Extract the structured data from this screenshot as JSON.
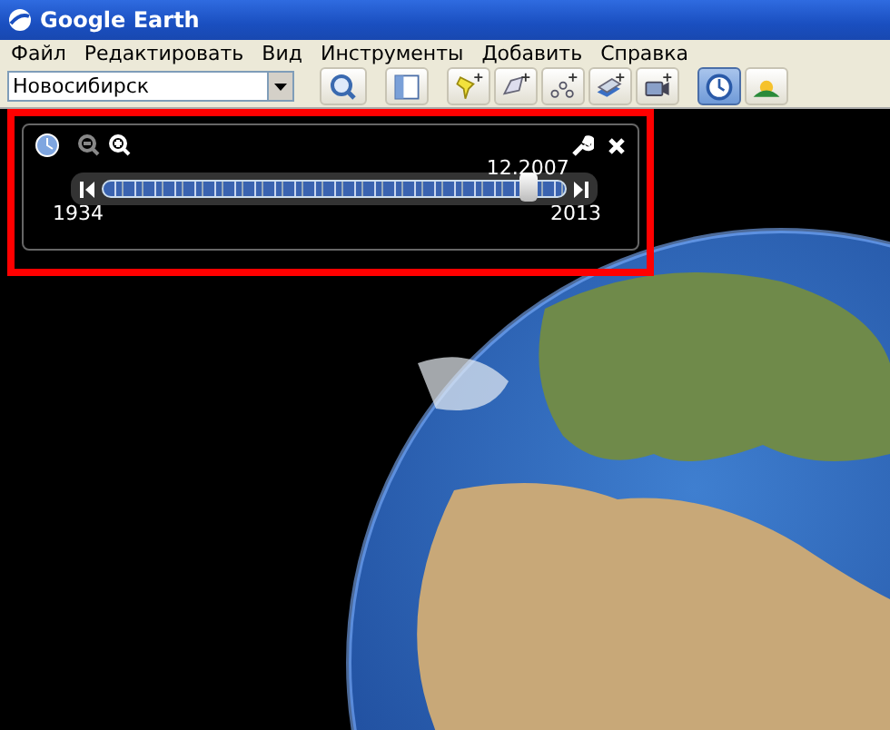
{
  "window": {
    "title": "Google Earth"
  },
  "menu": [
    {
      "label": "Файл"
    },
    {
      "label": "Редактировать"
    },
    {
      "label": "Вид"
    },
    {
      "label": "Инструменты"
    },
    {
      "label": "Добавить"
    },
    {
      "label": "Справка"
    }
  ],
  "search": {
    "value": "Новосибирск"
  },
  "toolbar": [
    {
      "kind": "sidebar",
      "selected": false
    },
    {
      "kind": "placemark",
      "selected": false
    },
    {
      "kind": "polygon",
      "selected": false
    },
    {
      "kind": "path",
      "selected": false
    },
    {
      "kind": "overlay",
      "selected": false
    },
    {
      "kind": "tour",
      "selected": false
    },
    {
      "kind": "history",
      "selected": true
    },
    {
      "kind": "sun",
      "selected": false
    }
  ],
  "time_slider": {
    "date": "12.2007",
    "start": "1934",
    "end": "2013",
    "level": 0.92
  }
}
